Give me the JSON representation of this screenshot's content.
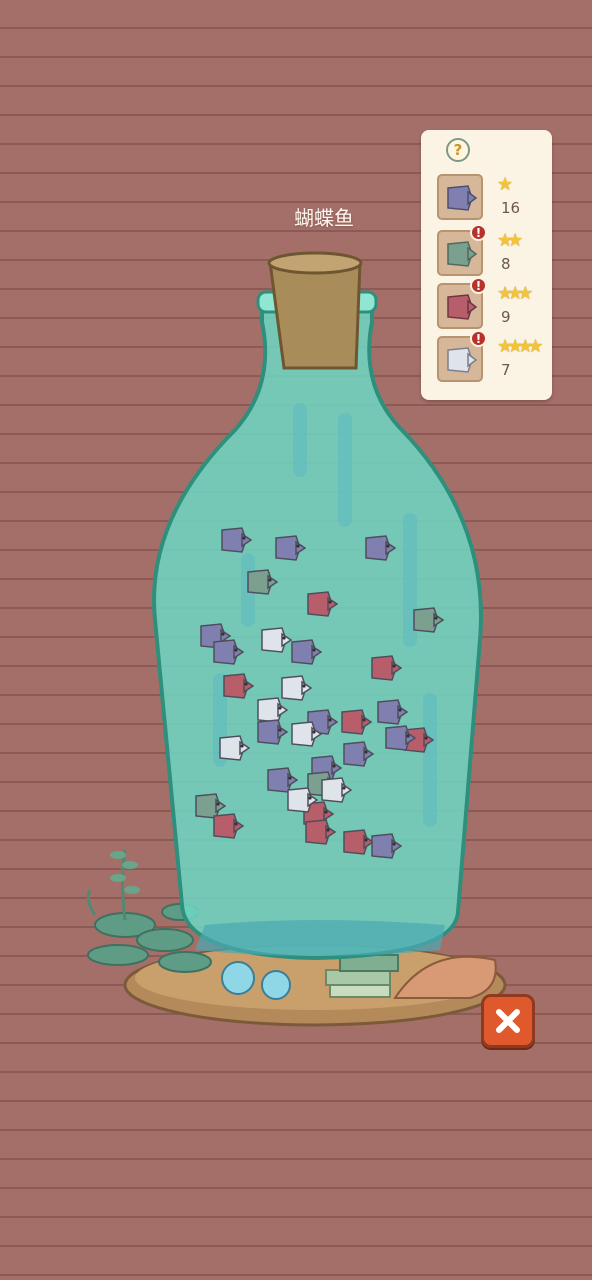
{
  "bottle": {
    "title": "蝴蝶鱼"
  },
  "collection": {
    "help_icon": "?",
    "alert_icon": "!",
    "entries": [
      {
        "fish_color": "#7f7fb0",
        "stars": 1,
        "count": "16",
        "alert": false
      },
      {
        "fish_color": "#7ba08f",
        "stars": 2,
        "count": "8",
        "alert": true
      },
      {
        "fish_color": "#b85d6a",
        "stars": 3,
        "count": "9",
        "alert": true
      },
      {
        "fish_color": "#dfe3ea",
        "stars": 4,
        "count": "7",
        "alert": true
      }
    ]
  },
  "close_icon": "close-x-icon",
  "colors": {
    "wall": "#a46f69",
    "bottle_glass": "#6fd8c4",
    "cork": "#a88c5a",
    "close_button": "#e0592d",
    "star": "#f3c33a"
  }
}
